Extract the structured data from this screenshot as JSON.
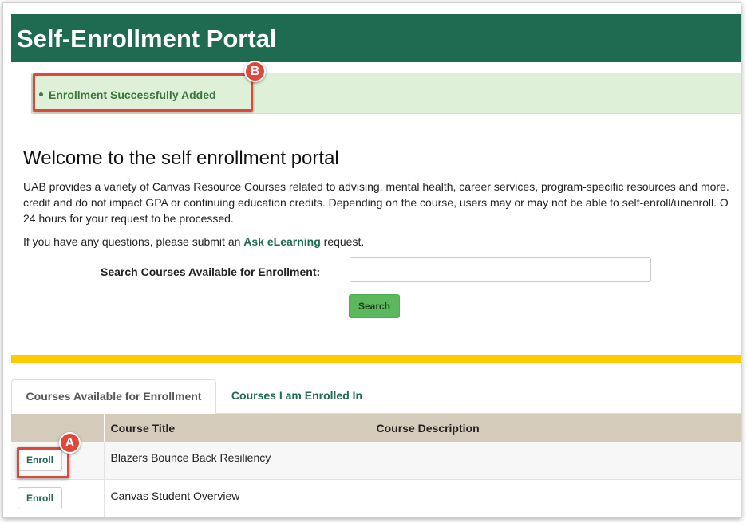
{
  "header": {
    "title": "Self-Enrollment Portal"
  },
  "alert": {
    "message": "Enrollment Successfully Added"
  },
  "callouts": {
    "a": "A",
    "b": "B"
  },
  "welcome": {
    "heading": "Welcome to the self enrollment portal",
    "intro_lines": [
      "UAB provides a variety of Canvas Resource Courses related to advising, mental health, career services, program-specific resources and more.",
      "credit and do not impact GPA or continuing education credits. Depending on the course, users may or may not be able to self-enroll/unenroll. O",
      "24 hours for your request to be processed."
    ],
    "questions_prefix": "If you have any questions, please submit an ",
    "questions_link": "Ask eLearning",
    "questions_suffix": " request."
  },
  "search": {
    "label": "Search Courses Available for Enrollment:",
    "value": "",
    "placeholder": "",
    "button_label": "Search"
  },
  "tabs": [
    {
      "label": "Courses Available for Enrollment",
      "active": true
    },
    {
      "label": "Courses I am Enrolled In",
      "active": false
    }
  ],
  "table": {
    "headers": [
      "",
      "Course Title",
      "Course Description"
    ],
    "rows": [
      {
        "action": "Enroll",
        "title": "Blazers Bounce Back Resiliency",
        "description": ""
      },
      {
        "action": "Enroll",
        "title": "Canvas Student Overview",
        "description": ""
      }
    ]
  },
  "colors": {
    "header_green": "#1e6b52",
    "alert_bg": "#dff0d8",
    "alert_text": "#3c763d",
    "divider_gold": "#ffcc00",
    "search_button": "#5cb85c",
    "table_header": "#d5cbbb",
    "callout_red": "#e0463a"
  }
}
